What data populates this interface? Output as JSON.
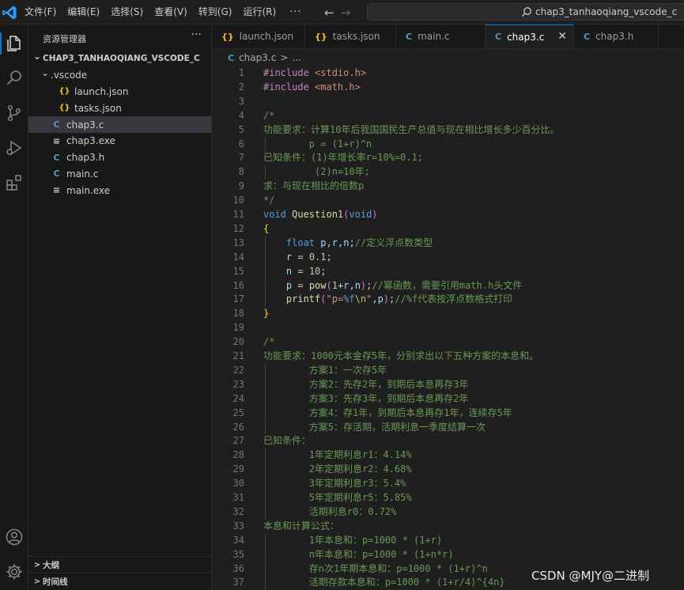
{
  "menu": {
    "items": [
      "文件(F)",
      "编辑(E)",
      "选择(S)",
      "查看(V)",
      "转到(G)",
      "运行(R)"
    ],
    "more": "···"
  },
  "search": {
    "text": "chap3_tanhaoqiang_vscode_c"
  },
  "sidebar": {
    "title": "资源管理器",
    "more": "···",
    "tree": [
      {
        "label": "CHAP3_TANHAOQIANG_VSCODE_C",
        "depth": 0,
        "chevron": "v",
        "icon": "",
        "kind": "root"
      },
      {
        "label": ".vscode",
        "depth": 1,
        "chevron": "v",
        "icon": "",
        "kind": "folder"
      },
      {
        "label": "launch.json",
        "depth": 2,
        "chevron": "",
        "icon": "{}",
        "kind": "json"
      },
      {
        "label": "tasks.json",
        "depth": 2,
        "chevron": "",
        "icon": "{}",
        "kind": "json"
      },
      {
        "label": "chap3.c",
        "depth": 1,
        "chevron": "",
        "icon": "C",
        "kind": "c",
        "selected": true
      },
      {
        "label": "chap3.exe",
        "depth": 1,
        "chevron": "",
        "icon": "≡",
        "kind": "exe"
      },
      {
        "label": "chap3.h",
        "depth": 1,
        "chevron": "",
        "icon": "C",
        "kind": "h"
      },
      {
        "label": "main.c",
        "depth": 1,
        "chevron": "",
        "icon": "C",
        "kind": "c"
      },
      {
        "label": "main.exe",
        "depth": 1,
        "chevron": "",
        "icon": "≡",
        "kind": "exe"
      }
    ],
    "outline_label": "大纲",
    "timeline_label": "时间线"
  },
  "tabs": [
    {
      "label": "launch.json",
      "icon": "{}",
      "kind": "json"
    },
    {
      "label": "tasks.json",
      "icon": "{}",
      "kind": "json"
    },
    {
      "label": "main.c",
      "icon": "C",
      "kind": "c"
    },
    {
      "label": "chap3.c",
      "icon": "C",
      "kind": "c",
      "active": true,
      "close": "✕"
    },
    {
      "label": "chap3.h",
      "icon": "C",
      "kind": "h"
    }
  ],
  "breadcrumb": {
    "icon": "C",
    "file": "chap3.c",
    "sep": ">",
    "rest": "..."
  },
  "editor": {
    "lines": [
      [
        [
          "k",
          "#include "
        ],
        [
          "s",
          "<stdio.h>"
        ]
      ],
      [
        [
          "k",
          "#include "
        ],
        [
          "s",
          "<math.h>"
        ]
      ],
      [],
      [
        [
          "cm",
          "/*"
        ]
      ],
      [
        [
          "cm",
          "功能要求：计算10年后我国国民生产总值与现在相比增长多少百分比。"
        ]
      ],
      [
        [
          "cm",
          "        p = (1+r)^n"
        ]
      ],
      [
        [
          "cm",
          "已知条件：(1)年增长率r=10%=0.1;"
        ]
      ],
      [
        [
          "cm",
          "         (2)n=10年;"
        ]
      ],
      [
        [
          "cm",
          "求：与现在相比的倍数p"
        ]
      ],
      [
        [
          "cm",
          "*/"
        ]
      ],
      [
        [
          "ty",
          "void "
        ],
        [
          "fn",
          "Question1"
        ],
        [
          "br2",
          "("
        ],
        [
          "ty",
          "void"
        ],
        [
          "br2",
          ")"
        ]
      ],
      [
        [
          "br",
          "{"
        ]
      ],
      [
        [
          "p",
          "    "
        ],
        [
          "ty",
          "float "
        ],
        [
          "v",
          "p"
        ],
        [
          "p",
          ","
        ],
        [
          "v",
          "r"
        ],
        [
          "p",
          ","
        ],
        [
          "v",
          "n"
        ],
        [
          "p",
          ";"
        ],
        [
          "cm",
          "//定义浮点数类型"
        ]
      ],
      [
        [
          "p",
          "    "
        ],
        [
          "v",
          "r"
        ],
        [
          "p",
          " = "
        ],
        [
          "n",
          "0.1"
        ],
        [
          "p",
          ";"
        ]
      ],
      [
        [
          "p",
          "    "
        ],
        [
          "v",
          "n"
        ],
        [
          "p",
          " = "
        ],
        [
          "n",
          "10"
        ],
        [
          "p",
          ";"
        ]
      ],
      [
        [
          "p",
          "    "
        ],
        [
          "v",
          "p"
        ],
        [
          "p",
          " = "
        ],
        [
          "fn",
          "pow"
        ],
        [
          "br2",
          "("
        ],
        [
          "n",
          "1"
        ],
        [
          "p",
          "+"
        ],
        [
          "v",
          "r"
        ],
        [
          "p",
          ","
        ],
        [
          "v",
          "n"
        ],
        [
          "br2",
          ")"
        ],
        [
          "p",
          ";"
        ],
        [
          "cm",
          "//幂函数，需要引用math.h头文件"
        ]
      ],
      [
        [
          "p",
          "    "
        ],
        [
          "fn",
          "printf"
        ],
        [
          "br2",
          "("
        ],
        [
          "s",
          "\"p="
        ],
        [
          "ty",
          "%f"
        ],
        [
          "esc",
          "\\n"
        ],
        [
          "s",
          "\""
        ],
        [
          "p",
          ","
        ],
        [
          "v",
          "p"
        ],
        [
          "br2",
          ")"
        ],
        [
          "p",
          ";"
        ],
        [
          "cm",
          "//%f代表按浮点数格式打印"
        ]
      ],
      [
        [
          "br",
          "}"
        ]
      ],
      [],
      [
        [
          "cm",
          "/*"
        ]
      ],
      [
        [
          "cm",
          "功能要求：1000元本金存5年，分别求出以下五种方案的本息和。"
        ]
      ],
      [
        [
          "cm",
          "        方案1：一次存5年"
        ]
      ],
      [
        [
          "cm",
          "        方案2：先存2年，到期后本息再存3年"
        ]
      ],
      [
        [
          "cm",
          "        方案3：先存3年，到期后本息再存2年"
        ]
      ],
      [
        [
          "cm",
          "        方案4：存1年，到期后本息再存1年，连续存5年"
        ]
      ],
      [
        [
          "cm",
          "        方案5：存活期，活期利息一季度结算一次"
        ]
      ],
      [
        [
          "cm",
          "已知条件："
        ]
      ],
      [
        [
          "cm",
          "        1年定期利息r1：4.14%"
        ]
      ],
      [
        [
          "cm",
          "        2年定期利息r2：4.68%"
        ]
      ],
      [
        [
          "cm",
          "        3年定期利息r3：5.4%"
        ]
      ],
      [
        [
          "cm",
          "        5年定期利息r5：5.85%"
        ]
      ],
      [
        [
          "cm",
          "        活期利息r0：0.72%"
        ]
      ],
      [
        [
          "cm",
          "本息和计算公式："
        ]
      ],
      [
        [
          "cm",
          "        1年本息和：p=1000 * (1+r)"
        ]
      ],
      [
        [
          "cm",
          "        n年本息和：p=1000 * (1+n*r)"
        ]
      ],
      [
        [
          "cm",
          "        存n次1年期本息和：p=1000 * (1+r)^n"
        ]
      ],
      [
        [
          "cm",
          "        活期存款本息和：p=1000 * (1+r/4)^{4n}"
        ]
      ]
    ]
  },
  "watermark": "CSDN @MJY@二进制",
  "colors": {
    "accent": "#0078d4",
    "comment": "#6a9955",
    "keyword": "#569cd6",
    "string": "#ce9178"
  }
}
